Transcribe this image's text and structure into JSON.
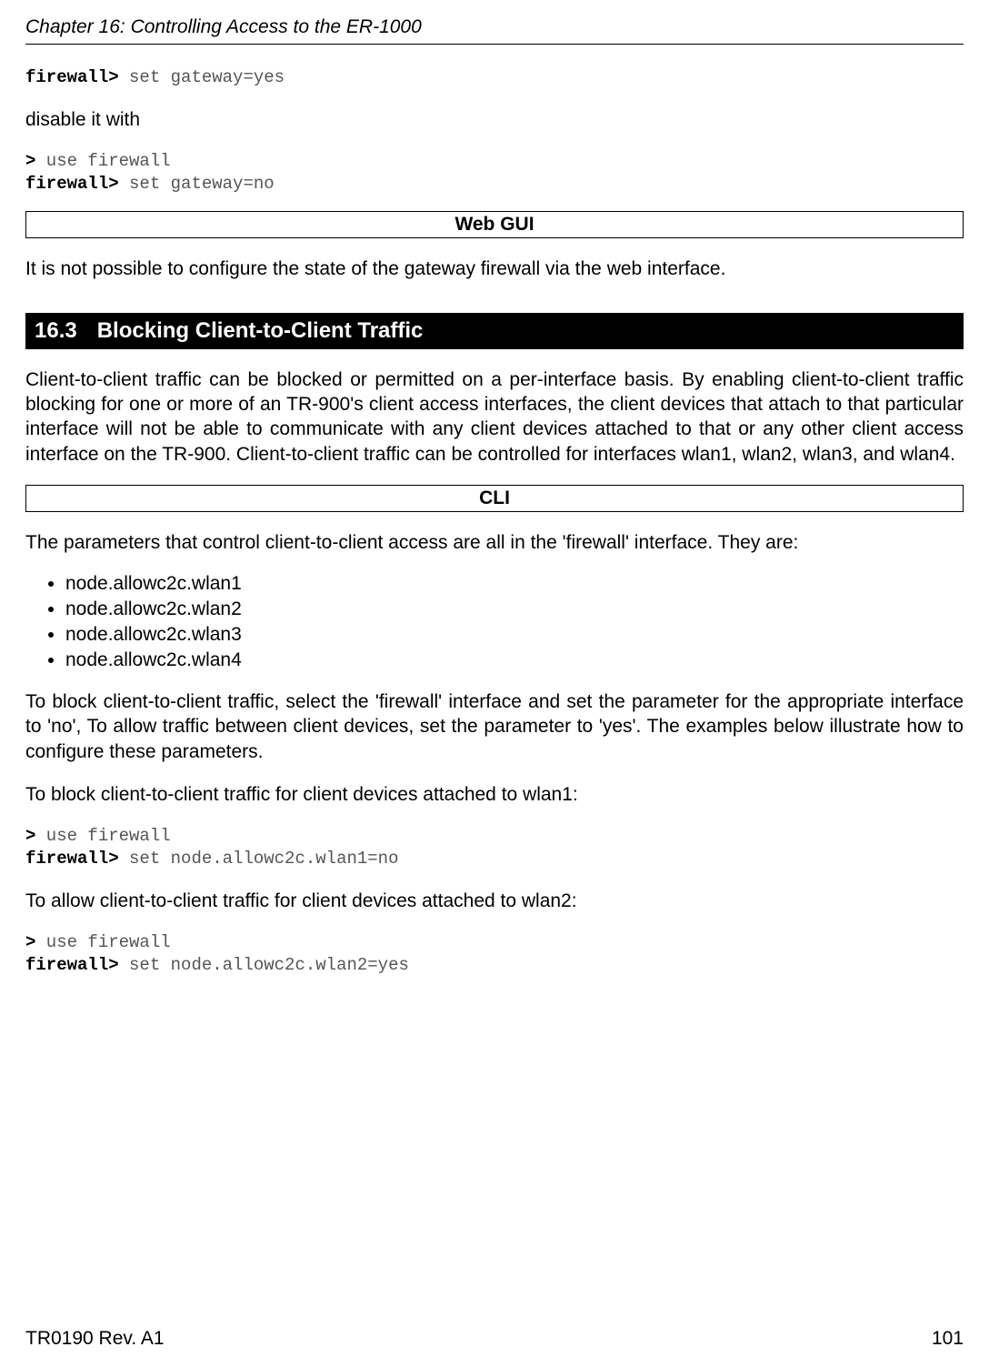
{
  "header": "Chapter 16: Controlling Access to the ER-1000",
  "code1": {
    "prompt": "firewall>",
    "cmd": " set gateway=yes"
  },
  "text1": "disable it with",
  "code2": {
    "l1_prompt": ">",
    "l1_cmd": " use firewall",
    "l2_prompt": "firewall>",
    "l2_cmd": " set gateway=no"
  },
  "boxhead1": "Web GUI",
  "text2": "It is not possible to configure the state of the gateway firewall via the web interface.",
  "section": {
    "num": "16.3",
    "title": "Blocking Client-to-Client Traffic"
  },
  "para1": "Client-to-client traffic can be blocked or permitted on a per-interface basis. By enabling client-to-client traffic blocking for one or more of an TR-900's client access interfaces, the client devices that attach to that particular interface will not be able to communicate with any client devices attached to that or any other client access interface on the TR-900. Client-to-client traffic can be controlled for interfaces wlan1, wlan2, wlan3, and wlan4.",
  "boxhead2": "CLI",
  "text3": "The parameters that control client-to-client access are all in the 'firewall' interface. They are:",
  "bullets": [
    "node.allowc2c.wlan1",
    "node.allowc2c.wlan2",
    "node.allowc2c.wlan3",
    "node.allowc2c.wlan4"
  ],
  "para2": "To block client-to-client traffic, select the 'firewall' interface and set the parameter for the appropriate interface to 'no', To allow traffic between client devices, set the parameter to 'yes'. The examples below illustrate how to configure these parameters.",
  "text4": "To block client-to-client traffic for client devices attached to wlan1:",
  "code3": {
    "l1_prompt": ">",
    "l1_cmd": " use firewall",
    "l2_prompt": "firewall>",
    "l2_cmd": " set node.allowc2c.wlan1=no"
  },
  "text5": "To allow client-to-client traffic for client devices attached to wlan2:",
  "code4": {
    "l1_prompt": ">",
    "l1_cmd": " use firewall",
    "l2_prompt": "firewall>",
    "l2_cmd": " set node.allowc2c.wlan2=yes"
  },
  "footer": {
    "left": "TR0190 Rev. A1",
    "right": "101"
  }
}
